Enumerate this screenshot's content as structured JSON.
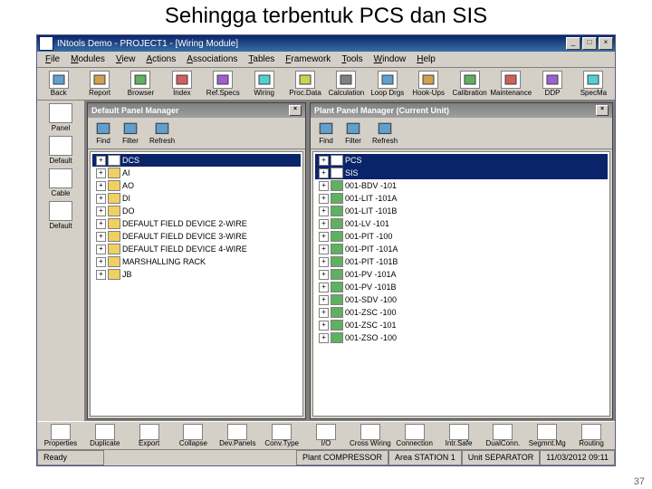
{
  "slide_title": "Sehingga terbentuk PCS dan SIS",
  "page_number": "37",
  "win": {
    "title": "INtools Demo - PROJECT1 - [Wiring Module]",
    "min": "_",
    "max": "□",
    "close": "×"
  },
  "menu": [
    "File",
    "Modules",
    "View",
    "Actions",
    "Associations",
    "Tables",
    "Framework",
    "Tools",
    "Window",
    "Help"
  ],
  "toolbar": [
    {
      "label": "Back",
      "icon": "back"
    },
    {
      "label": "Report",
      "icon": "rep"
    },
    {
      "label": "Browser",
      "icon": "brw"
    },
    {
      "label": "Index",
      "icon": "idx"
    },
    {
      "label": "Ref.Specs",
      "icon": "ref"
    },
    {
      "label": "Wiring",
      "icon": "wir"
    },
    {
      "label": "Proc.Data",
      "icon": "pd"
    },
    {
      "label": "Calculation",
      "icon": "cal"
    },
    {
      "label": "Loop Drgs",
      "icon": "lp"
    },
    {
      "label": "Hook-Ups",
      "icon": "hu"
    },
    {
      "label": "Calibration",
      "icon": "cb"
    },
    {
      "label": "Maintenance",
      "icon": "mn"
    },
    {
      "label": "DDP",
      "icon": "dd"
    },
    {
      "label": "SpecMa",
      "icon": "sp"
    }
  ],
  "left_sidebar": [
    {
      "label": "Panel"
    },
    {
      "label": "Default"
    },
    {
      "label": "Cable"
    },
    {
      "label": "Default"
    }
  ],
  "panel_left": {
    "title": "Default Panel Manager",
    "tools": [
      {
        "label": "Find"
      },
      {
        "label": "Filter"
      },
      {
        "label": "Refresh"
      }
    ],
    "items": [
      {
        "label": "DCS",
        "sel": true
      },
      {
        "label": "AI",
        "sel": false
      },
      {
        "label": "AO",
        "sel": false
      },
      {
        "label": "DI",
        "sel": false
      },
      {
        "label": "DO",
        "sel": false
      },
      {
        "label": "DEFAULT FIELD DEVICE 2-WIRE",
        "sel": false
      },
      {
        "label": "DEFAULT FIELD DEVICE 3-WIRE",
        "sel": false
      },
      {
        "label": "DEFAULT FIELD DEVICE 4-WIRE",
        "sel": false
      },
      {
        "label": "MARSHALLING RACK",
        "sel": false
      },
      {
        "label": "JB",
        "sel": false
      }
    ]
  },
  "panel_right": {
    "title": "Plant Panel Manager (Current Unit)",
    "tools": [
      {
        "label": "Find"
      },
      {
        "label": "Filter"
      },
      {
        "label": "Refresh"
      }
    ],
    "items": [
      {
        "label": "PCS",
        "sel": true
      },
      {
        "label": "SIS",
        "sel": true
      },
      {
        "label": "001-BDV -101",
        "sel": false
      },
      {
        "label": "001-LIT -101A",
        "sel": false
      },
      {
        "label": "001-LIT -101B",
        "sel": false
      },
      {
        "label": "001-LV  -101",
        "sel": false
      },
      {
        "label": "001-PIT -100",
        "sel": false
      },
      {
        "label": "001-PIT -101A",
        "sel": false
      },
      {
        "label": "001-PIT -101B",
        "sel": false
      },
      {
        "label": "001-PV  -101A",
        "sel": false
      },
      {
        "label": "001-PV  -101B",
        "sel": false
      },
      {
        "label": "001-SDV -100",
        "sel": false
      },
      {
        "label": "001-ZSC -100",
        "sel": false
      },
      {
        "label": "001-ZSC -101",
        "sel": false
      },
      {
        "label": "001-ZSO -100",
        "sel": false
      }
    ]
  },
  "bottom": [
    {
      "label": "Properties"
    },
    {
      "label": "Duplicate"
    },
    {
      "label": "Export"
    },
    {
      "label": "Collapse"
    },
    {
      "label": "Dev.Panels"
    },
    {
      "label": "Conv.Type"
    },
    {
      "label": "I/O"
    },
    {
      "label": "Cross Wiring"
    },
    {
      "label": "Connection"
    },
    {
      "label": "Intr.Safe"
    },
    {
      "label": "DualConn."
    },
    {
      "label": "Segmnt.Mg"
    },
    {
      "label": "Routing"
    }
  ],
  "status": {
    "ready": "Ready",
    "plant": "Plant COMPRESSOR",
    "area": "Area STATION 1",
    "unit": "Unit SEPARATOR",
    "time": "11/03/2012 09:11"
  }
}
